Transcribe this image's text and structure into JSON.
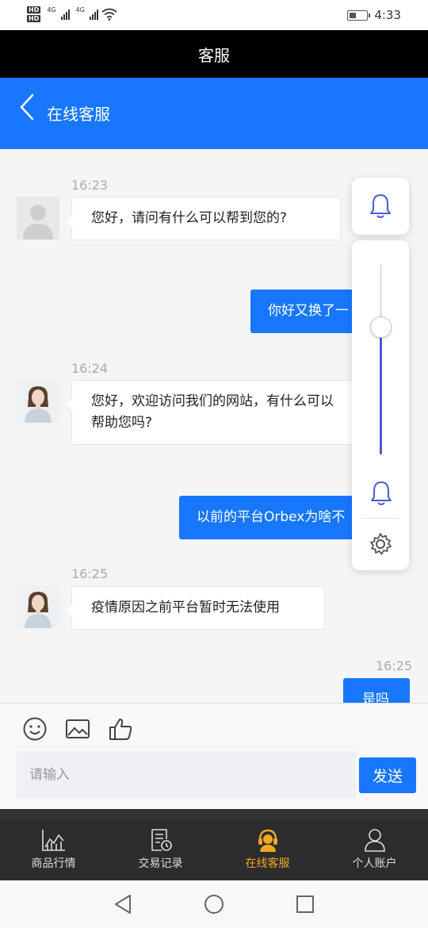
{
  "status_bar": {
    "hd1": "HD",
    "hd2": "HD",
    "net1": "4G",
    "net2": "4G",
    "time": "4:33",
    "icons": [
      "signal-icon",
      "wifi-icon",
      "battery-icon"
    ]
  },
  "app_title": "客服",
  "header": {
    "back_icon": "chevron-left-icon",
    "title": "在线客服"
  },
  "messages": [
    {
      "time": "16:23",
      "side": "left",
      "avatar": "default-avatar",
      "text": "您好，请问有什么可以帮到您的?"
    },
    {
      "side": "right",
      "text": "你好又换了一"
    },
    {
      "time": "16:24",
      "side": "left",
      "avatar": "agent-avatar",
      "text": "您好，欢迎访问我们的网站，有什么可以帮助您吗?"
    },
    {
      "side": "right",
      "text": "以前的平台Orbex为啥不"
    },
    {
      "time": "16:25",
      "side": "left",
      "avatar": "agent-avatar",
      "text": "疫情原因之前平台暂时无法使用"
    },
    {
      "time": "16:25",
      "side": "right",
      "text": "是吗"
    }
  ],
  "volume_panel": {
    "level": 0.67,
    "icons": [
      "bell-icon",
      "bell-icon",
      "gear-icon"
    ]
  },
  "input_area": {
    "tools": [
      "emoji-icon",
      "image-icon",
      "thumbs-up-icon"
    ],
    "placeholder": "请输入",
    "send_label": "发送"
  },
  "bottom_nav": {
    "items": [
      {
        "label": "商品行情",
        "icon": "chart-icon",
        "active": false
      },
      {
        "label": "交易记录",
        "icon": "record-icon",
        "active": false
      },
      {
        "label": "在线客服",
        "icon": "headset-icon",
        "active": true
      },
      {
        "label": "个人账户",
        "icon": "user-icon",
        "active": false
      }
    ]
  },
  "colors": {
    "accent": "#1777ff",
    "active_nav": "#f0a824",
    "slider": "#4a5bd4"
  }
}
